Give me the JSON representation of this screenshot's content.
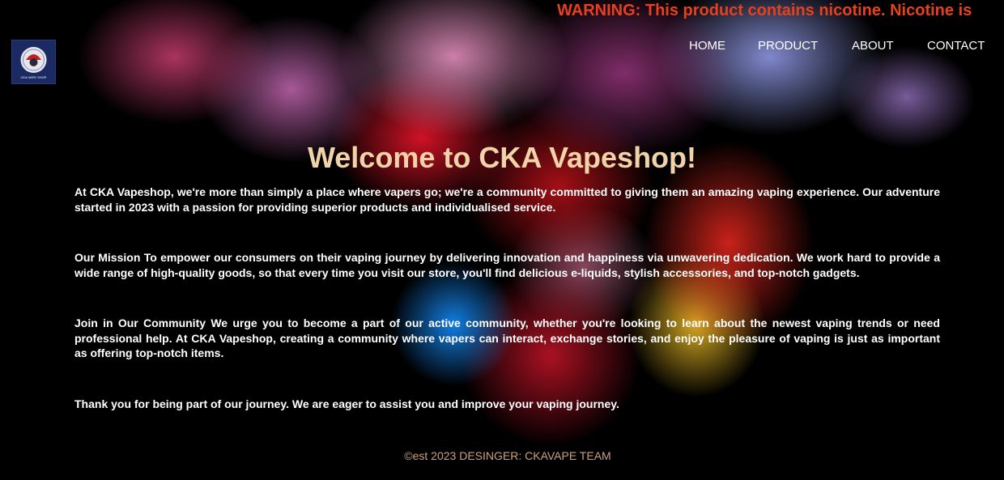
{
  "warning": "WARNING: This product contains nicotine. Nicotine is",
  "logo": {
    "text": "CKA VAPE SHOP"
  },
  "nav": {
    "home": "HOME",
    "product": "PRODUCT",
    "about": "ABOUT",
    "contact": "CONTACT"
  },
  "main": {
    "title": "Welcome to CKA Vapeshop!",
    "paragraphs": [
      "At CKA Vapeshop, we're more than simply a place where vapers go; we're a community committed to giving them an amazing vaping experience. Our adventure started in 2023 with a passion for providing superior products and individualised service.",
      "Our Mission To empower our consumers on their vaping journey by delivering innovation and happiness via unwavering dedication. We work hard to provide a wide range of high-quality goods, so that every time you visit our store, you'll find delicious e-liquids, stylish accessories, and top-notch gadgets.",
      "Join in Our Community We urge you to become a part of our active community, whether you're looking to learn about the newest vaping trends or need professional help. At CKA Vapeshop, creating a community where vapers can interact, exchange stories, and enjoy the pleasure of vaping is just as important as offering top-notch items.",
      "Thank you for being part of our journey. We are eager to assist you and improve your vaping journey."
    ]
  },
  "footer": {
    "text": "©est 2023 DESINGER: CKAVAPE TEAM"
  },
  "colors": {
    "warning": "#e8401c",
    "title": "#f0d3a8",
    "footer": "#c9a27f",
    "background": "#000000"
  }
}
